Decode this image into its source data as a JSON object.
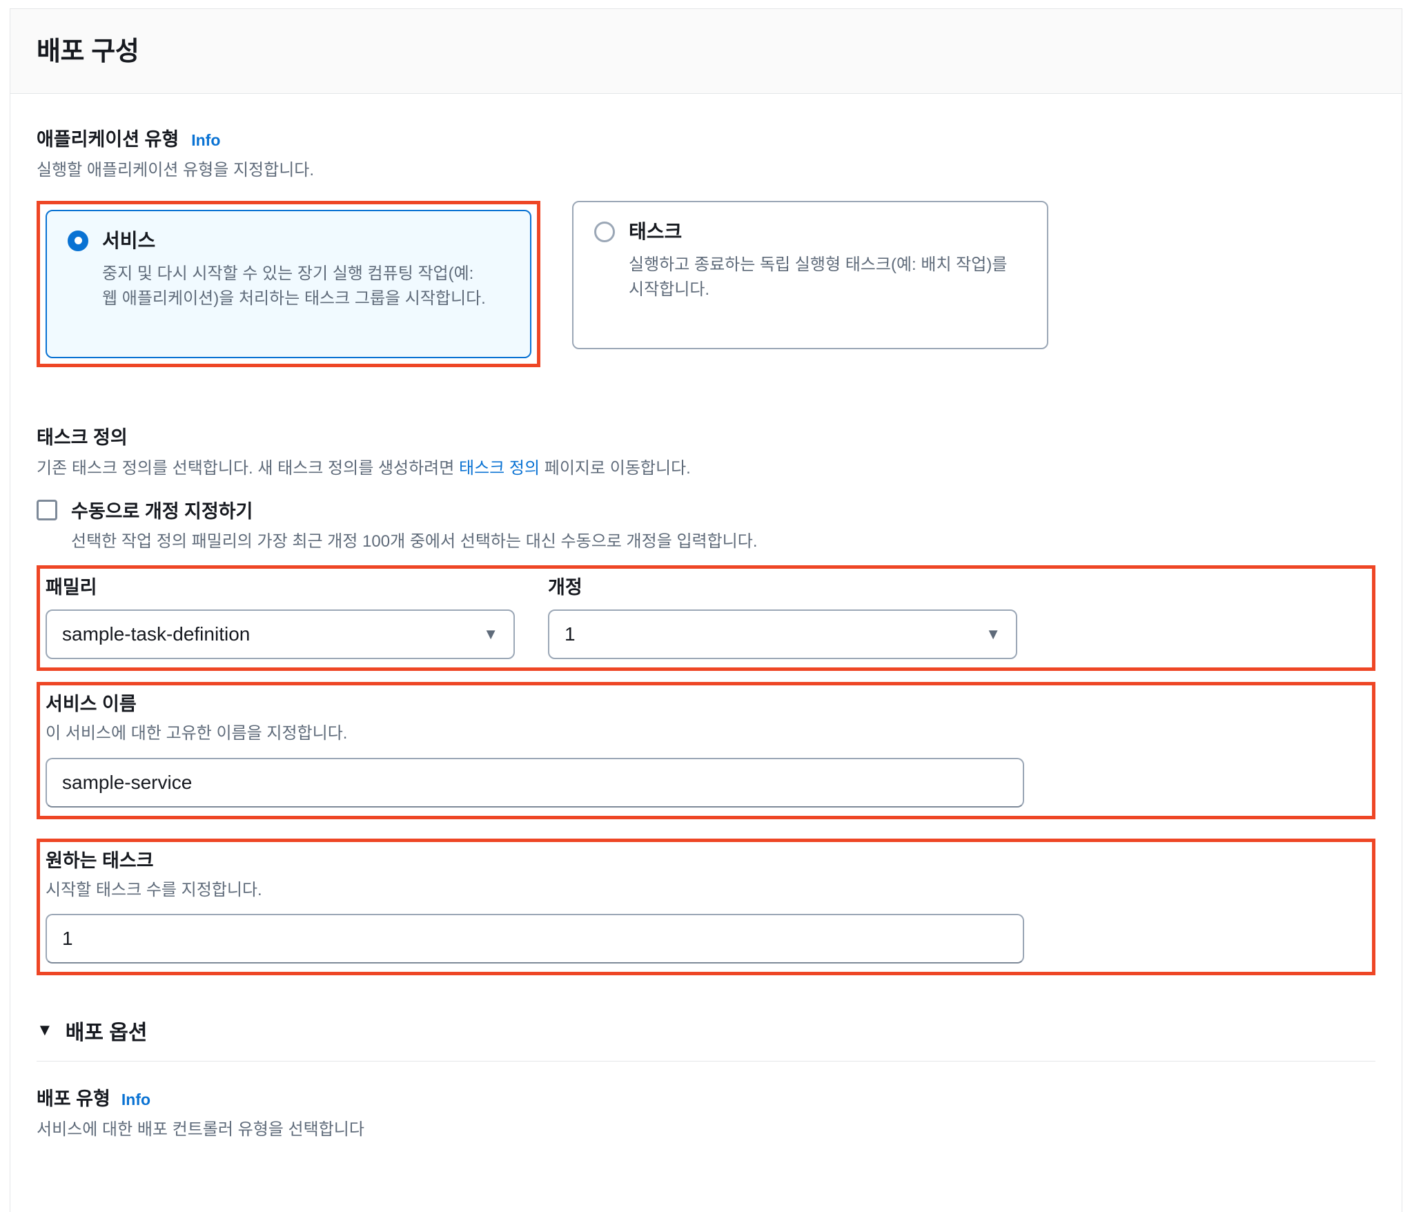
{
  "header": {
    "title": "배포 구성"
  },
  "application_type": {
    "label": "애플리케이션 유형",
    "info_label": "Info",
    "description": "실행할 애플리케이션 유형을 지정합니다.",
    "options": [
      {
        "title": "서비스",
        "description": "중지 및 다시 시작할 수 있는 장기 실행 컴퓨팅 작업(예: 웹 애플리케이션)을 처리하는 태스크 그룹을 시작합니다.",
        "selected": true
      },
      {
        "title": "태스크",
        "description": "실행하고 종료하는 독립 실행형 태스크(예: 배치 작업)를 시작합니다.",
        "selected": false
      }
    ]
  },
  "task_definition": {
    "label": "태스크 정의",
    "description_before": "기존 태스크 정의를 선택합니다. 새 태스크 정의를 생성하려면 ",
    "description_link": "태스크 정의",
    "description_after": " 페이지로 이동합니다.",
    "manual_revision_checkbox": {
      "label": "수동으로 개정 지정하기",
      "checked": false,
      "hint": "선택한 작업 정의 패밀리의 가장 최근 개정 100개 중에서 선택하는 대신 수동으로 개정을 입력합니다."
    },
    "family": {
      "label": "패밀리",
      "value": "sample-task-definition",
      "caret": "▼"
    },
    "revision": {
      "label": "개정",
      "value": "1",
      "caret": "▼"
    }
  },
  "service_name": {
    "label": "서비스 이름",
    "description": "이 서비스에 대한 고유한 이름을 지정합니다.",
    "value": "sample-service",
    "placeholder": ""
  },
  "desired_tasks": {
    "label": "원하는 태스크",
    "description": "시작할 태스크 수를 지정합니다.",
    "value": "1",
    "placeholder": ""
  },
  "deployment_options": {
    "caret": "▼",
    "title": "배포 옵션"
  },
  "deployment_type": {
    "label": "배포 유형",
    "info_label": "Info",
    "description": "서비스에 대한 배포 컨트롤러 유형을 선택합니다"
  },
  "colors": {
    "annotation": "#ee4625",
    "accent": "#0972d3",
    "selected_card_bg": "#f1faff",
    "text": "#16191f",
    "muted_text": "#5f6b7a",
    "border": "#9ba7b6"
  }
}
